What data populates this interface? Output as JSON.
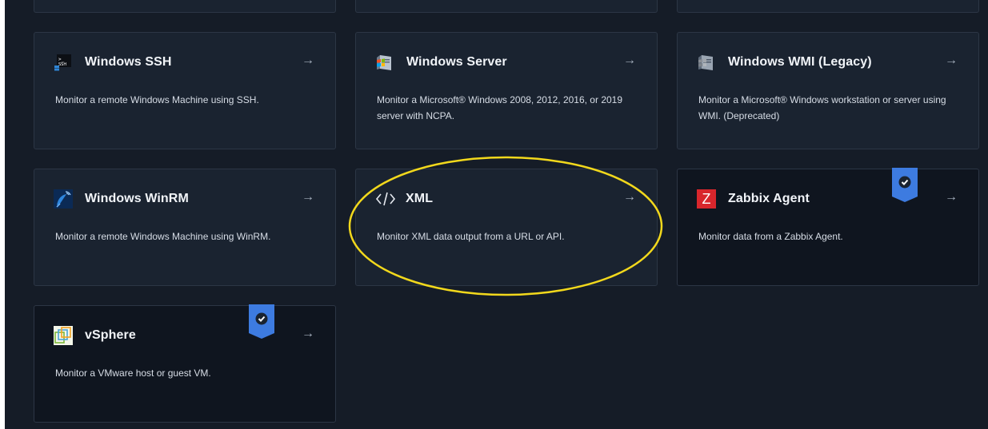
{
  "cards": [
    {
      "title": "Windows SSH",
      "description": "Monitor a remote Windows Machine using SSH.",
      "icon": "ssh-terminal-icon"
    },
    {
      "title": "Windows Server",
      "description": "Monitor a Microsoft® Windows 2008, 2012, 2016, or 2019 server with NCPA.",
      "icon": "windows-server-icon"
    },
    {
      "title": "Windows WMI (Legacy)",
      "description": "Monitor a Microsoft® Windows workstation or server using WMI. (Deprecated)",
      "icon": "windows-server-icon"
    },
    {
      "title": "Windows WinRM",
      "description": "Monitor a remote Windows Machine using WinRM.",
      "icon": "satellite-dish-icon"
    },
    {
      "title": "XML",
      "description": "Monitor XML data output from a URL or API.",
      "icon": "code-brackets-icon"
    },
    {
      "title": "Zabbix Agent",
      "description": "Monitor data from a Zabbix Agent.",
      "icon": "zabbix-z-icon",
      "icon_letter": "Z",
      "verified": true
    },
    {
      "title": "vSphere",
      "description": "Monitor a VMware host or guest VM.",
      "icon": "vsphere-icon",
      "verified": true
    }
  ],
  "colors": {
    "background": "#151c27",
    "card": "#1a2330",
    "card_highlighted": "#0f151f",
    "badge": "#3d7be0",
    "highlight_ellipse": "#f2d81c",
    "zabbix_red": "#d8262c"
  },
  "arrow_glyph": "→"
}
